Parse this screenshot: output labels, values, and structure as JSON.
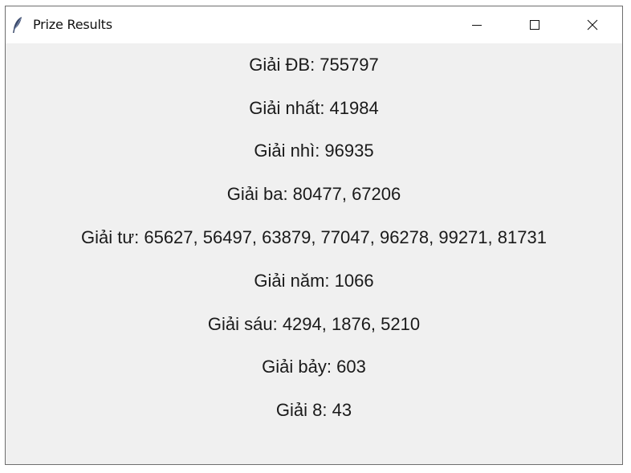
{
  "window": {
    "title": "Prize Results",
    "icon": "feather-icon",
    "controls": {
      "minimize": "minimize-icon",
      "maximize": "maximize-icon",
      "close": "close-icon"
    }
  },
  "results": [
    {
      "text": "Giải ĐB: 755797"
    },
    {
      "text": "Giải nhất: 41984"
    },
    {
      "text": "Giải nhì: 96935"
    },
    {
      "text": "Giải ba: 80477, 67206"
    },
    {
      "text": "Giải tư: 65627, 56497, 63879, 77047, 96278, 99271, 81731"
    },
    {
      "text": "Giải năm: 1066"
    },
    {
      "text": "Giải sáu: 4294, 1876, 5210"
    },
    {
      "text": "Giải bảy: 603"
    },
    {
      "text": "Giải 8: 43"
    }
  ]
}
